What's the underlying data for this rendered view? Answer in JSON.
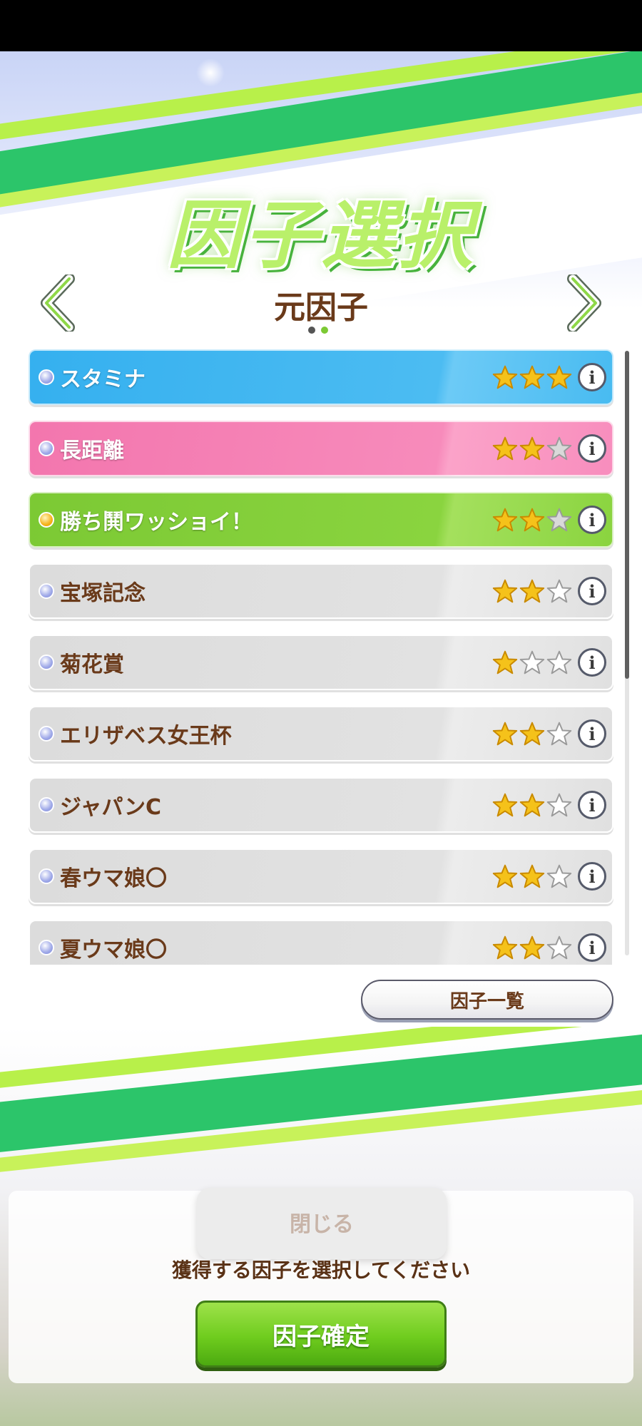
{
  "header": {
    "title": "因子選択",
    "subtitle": "元因子"
  },
  "pager": {
    "count": 2,
    "active": 2
  },
  "factors": [
    {
      "label": "スタミナ",
      "type": "blue",
      "stars": 3,
      "gold": false
    },
    {
      "label": "長距離",
      "type": "pink",
      "stars": 2,
      "gold": false
    },
    {
      "label": "勝ち鬨ワッショイ！",
      "type": "green",
      "stars": 2,
      "gold": true
    },
    {
      "label": "宝塚記念",
      "type": "gray",
      "stars": 2,
      "gold": false
    },
    {
      "label": "菊花賞",
      "type": "gray",
      "stars": 1,
      "gold": false
    },
    {
      "label": "エリザベス女王杯",
      "type": "gray",
      "stars": 2,
      "gold": false
    },
    {
      "label": "ジャパンC",
      "type": "gray",
      "stars": 2,
      "gold": false
    },
    {
      "label": "春ウマ娘〇",
      "type": "gray",
      "stars": 2,
      "gold": false
    },
    {
      "label": "夏ウマ娘〇",
      "type": "gray",
      "stars": 2,
      "gold": false
    }
  ],
  "info_glyph": "i",
  "buttons": {
    "factor_list": "因子一覧",
    "background_close": "閉じる",
    "confirm": "因子確定"
  },
  "instruction": "獲得する因子を選択してください",
  "colors": {
    "accent_green": "#7cc934",
    "text_brown": "#6a3a1a",
    "star_gold": "#f5c21a"
  }
}
